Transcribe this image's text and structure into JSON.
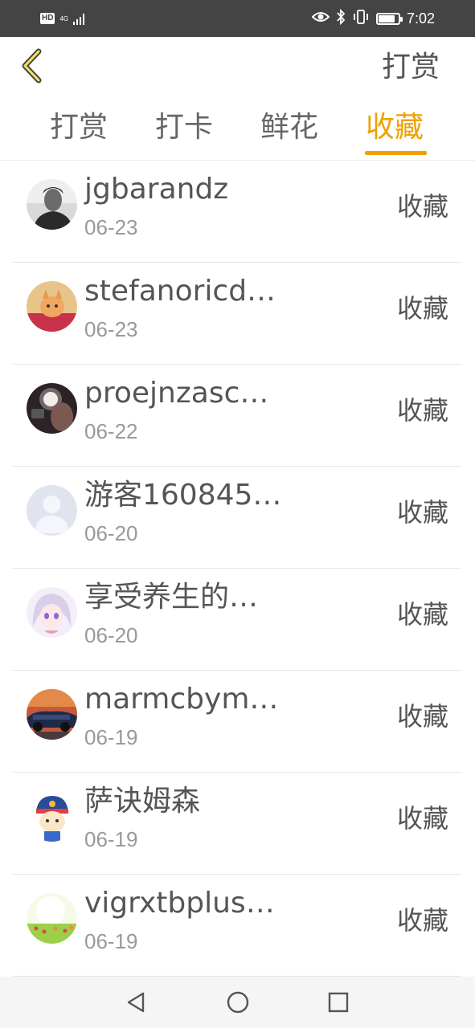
{
  "status_bar": {
    "hd": "HD",
    "network": "4G",
    "time": "7:02",
    "battery_level": 0.85
  },
  "header": {
    "title": "打赏"
  },
  "tabs": [
    {
      "label": "打赏",
      "active": false
    },
    {
      "label": "打卡",
      "active": false
    },
    {
      "label": "鲜花",
      "active": false
    },
    {
      "label": "收藏",
      "active": true
    }
  ],
  "list": {
    "items": [
      {
        "name": "jgbarandz",
        "date": "06-23",
        "action": "收藏",
        "avatar": "man-portrait"
      },
      {
        "name": "stefanoricd…",
        "date": "06-23",
        "action": "收藏",
        "avatar": "cat-photo"
      },
      {
        "name": "proejnzasc…",
        "date": "06-22",
        "action": "收藏",
        "avatar": "camera-selfie"
      },
      {
        "name": "游客160845…",
        "date": "06-20",
        "action": "收藏",
        "avatar": "default-user"
      },
      {
        "name": "享受养生的…",
        "date": "06-20",
        "action": "收藏",
        "avatar": "anime-girl"
      },
      {
        "name": "marmcbym…",
        "date": "06-19",
        "action": "收藏",
        "avatar": "car-photo"
      },
      {
        "name": "萨诀姆森",
        "date": "06-19",
        "action": "收藏",
        "avatar": "cartoon-character"
      },
      {
        "name": "vigrxtbplus…",
        "date": "06-19",
        "action": "收藏",
        "avatar": "flower-field"
      }
    ]
  },
  "colors": {
    "accent": "#f0a000",
    "status_bar_bg": "#444444",
    "text": "#555555",
    "date_text": "#999999",
    "divider": "#e4e4e4"
  }
}
